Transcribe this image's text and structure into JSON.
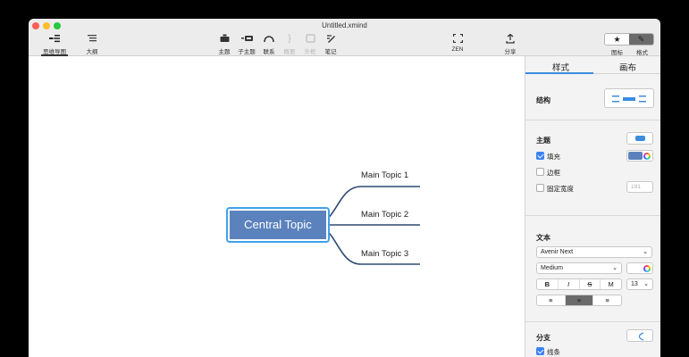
{
  "window": {
    "title": "Untitled.xmind"
  },
  "toolbar": {
    "views": [
      {
        "label": "思维导图",
        "icon": "mindmap-icon"
      },
      {
        "label": "大纲",
        "icon": "outline-icon"
      }
    ],
    "tools": [
      {
        "label": "主题",
        "icon": "topic-icon"
      },
      {
        "label": "子主题",
        "icon": "subtopic-icon"
      },
      {
        "label": "联系",
        "icon": "relationship-icon"
      },
      {
        "label": "概要",
        "icon": "summary-icon"
      },
      {
        "label": "外框",
        "icon": "boundary-icon"
      },
      {
        "label": "笔记",
        "icon": "note-icon"
      }
    ],
    "zen_label": "ZEN",
    "share_label": "分享",
    "right_labels": {
      "icons": "图标",
      "format": "格式"
    }
  },
  "map": {
    "central_topic": "Central Topic",
    "main_topics": [
      "Main Topic 1",
      "Main Topic 2",
      "Main Topic 3"
    ]
  },
  "panel": {
    "tabs": [
      "样式",
      "画布"
    ],
    "structure": {
      "heading": "结构"
    },
    "topic": {
      "heading": "主题",
      "fill_label": "填充",
      "border_label": "边框",
      "fixed_width_label": "固定宽度",
      "fixed_width_value": "191",
      "fill_color": "#5b82bd"
    },
    "text": {
      "heading": "文本",
      "font": "Avenir Next",
      "weight": "Medium",
      "style_buttons": [
        "B",
        "I",
        "S",
        "M"
      ],
      "size": "13"
    },
    "branch": {
      "heading": "分支",
      "line_label": "线条",
      "line_color": "#2f4a74"
    }
  },
  "colors": {
    "accent": "#3c8ce0",
    "topic": "#5b82bd",
    "branch_line": "#2f4a74"
  }
}
